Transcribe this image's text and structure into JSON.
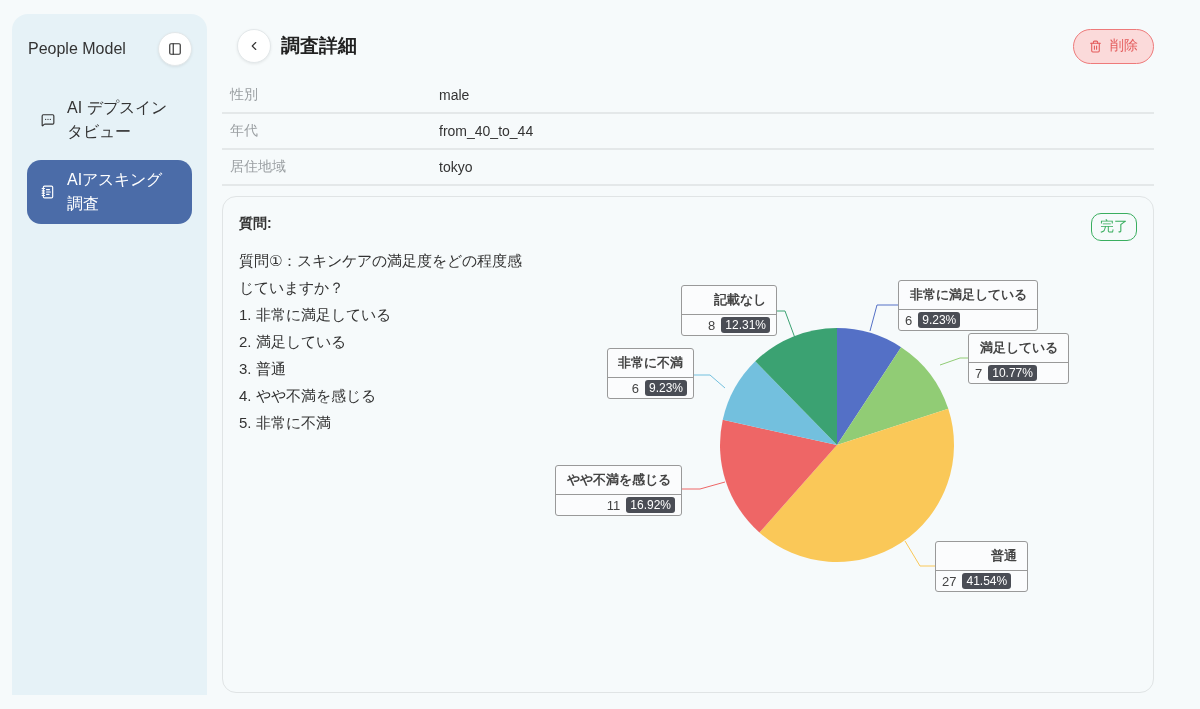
{
  "sidebar": {
    "title": "People Model",
    "items": [
      {
        "label": "AI デプスインタビュー",
        "kind": "chat",
        "selected": false
      },
      {
        "label": "AIアスキング調査",
        "kind": "survey",
        "selected": true
      }
    ]
  },
  "header": {
    "title": "調査詳細",
    "delete_button": "削除"
  },
  "attributes": [
    {
      "label": "性別",
      "value": "male"
    },
    {
      "label": "年代",
      "value": "from_40_to_44"
    },
    {
      "label": "居住地域",
      "value": "tokyo"
    }
  ],
  "question": {
    "heading": "質問:",
    "answer_counts": [
      "6",
      "7",
      "27",
      "11",
      "6",
      "8"
    ],
    "status": "完了",
    "text": "質問①：スキンケアの満足度をどの程度感じていますか？",
    "options": [
      "1. 非常に満足している",
      "2. 満足している",
      "3. 普通",
      "4. やや不満を感じる",
      "5. 非常に不満"
    ],
    "chart_data": {
      "type": "pie",
      "categories": [
        "非常に満足している",
        "満足している",
        "普通",
        "やや不満を感じる",
        "非常に不満",
        "記載なし"
      ],
      "values": [
        9.23,
        10.77,
        41.54,
        16.92,
        9.23,
        12.31
      ],
      "colors": [
        "#5470c6",
        "#91cc75",
        "#fac858",
        "#ee6666",
        "#73c0de",
        "#3ba272"
      ],
      "data_labels": true,
      "value_labels": [
        "9.23%",
        "10.77%",
        "41.54%",
        "16.92%",
        "9.23%",
        "12.31%"
      ]
    }
  }
}
